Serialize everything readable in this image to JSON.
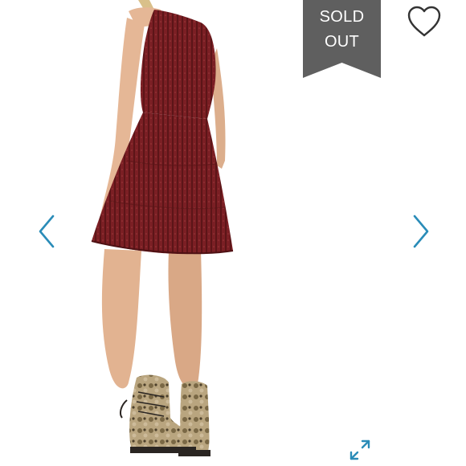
{
  "badge": {
    "line1": "SOLD",
    "line2": "OUT",
    "color": "#5f5f5f"
  },
  "icons": {
    "like": "heart-outline-icon",
    "previous": "chevron-left-icon",
    "next": "chevron-right-icon",
    "expand": "expand-arrows-icon"
  },
  "colors": {
    "accent": "#2a8cb8",
    "dress": "#7a1f22"
  }
}
